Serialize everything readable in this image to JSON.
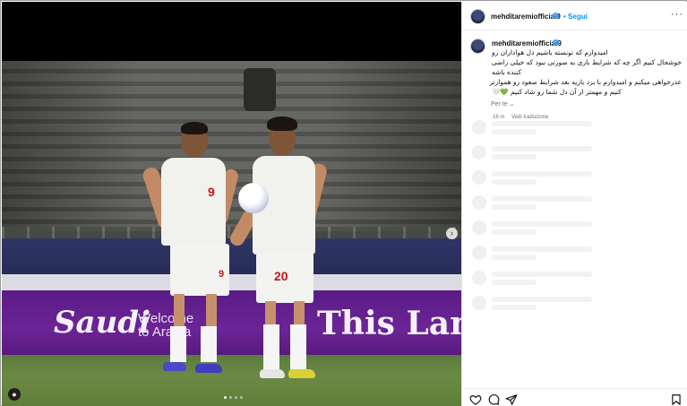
{
  "post": {
    "username": "mehditaremiofficial9",
    "verified": true,
    "follow_label": "Segui",
    "more_icon": "more-horizontal-icon"
  },
  "caption": {
    "username": "mehditaremiofficial9",
    "lines": [
      "امیدوارم که تونسته باشیم دل هواداران رو",
      "خوشحال کنیم اگر چه که شرایط بازی به صورتی نبود که خیلی راضی",
      "کننده باشه",
      "عذرخواهی میکنم و امیدوارم با برد بازیه بعد شرایط صعود رو هموارتر",
      "کنیم و مهمتر از آن دل شما رو شاد کنیم 💚🤍"
    ],
    "time": "16 m",
    "translate_label": "Vedi traduzione"
  },
  "recommendations": {
    "label": "Per te",
    "chevron_icon": "chevron-down-icon",
    "placeholder_count_note": ""
  },
  "media": {
    "ad_saudi": "Saudi",
    "ad_welcome_1": "Welcome",
    "ad_welcome_2": "to Arabia",
    "ad_this": "This Lan",
    "number_left": "9",
    "number_right": "20",
    "carousel_next_icon": "chevron-right-icon",
    "carousel_dots": 4,
    "carousel_active": 0,
    "tag_icon": "user-tag-icon"
  },
  "actions": {
    "like_icon": "heart-icon",
    "comment_icon": "comment-icon",
    "share_icon": "send-icon",
    "save_icon": "bookmark-icon"
  },
  "colors": {
    "accent": "#0095f6",
    "verified": "#3897f0",
    "jersey_number": "#c4161c",
    "board_purple": "#6c2496"
  }
}
